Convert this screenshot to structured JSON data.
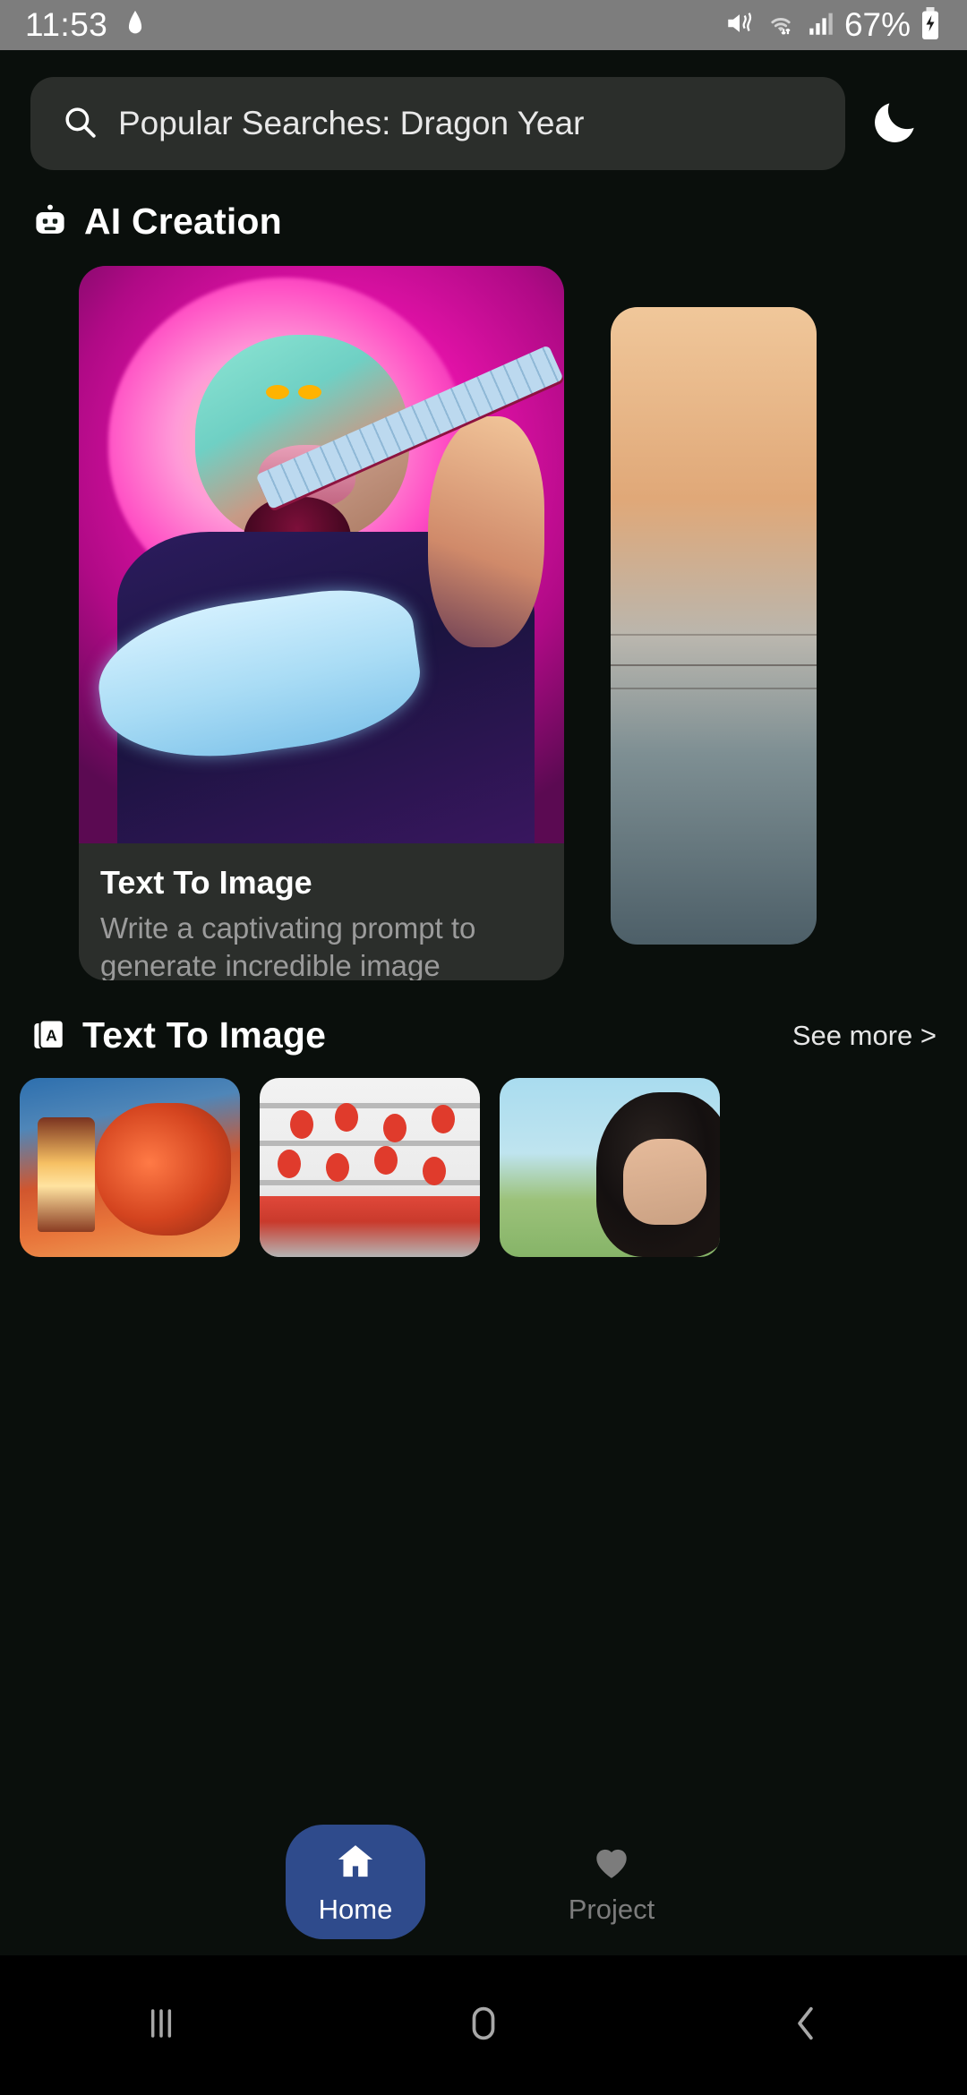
{
  "statusbar": {
    "time": "11:53",
    "battery_percent": "67%",
    "icons": [
      "home-indicator-icon",
      "mute-vibrate-icon",
      "wifi-icon",
      "signal-icon",
      "battery-charging-icon"
    ]
  },
  "search": {
    "placeholder": "Popular Searches: Dragon Year",
    "value": "",
    "icon": "search-icon",
    "theme_toggle_icon": "moon-icon"
  },
  "sections": [
    {
      "title": "AI Creation",
      "icon": "robot-icon",
      "cards": [
        {
          "title": "Text To Image",
          "description": "Write a captivating prompt to generate incredible image",
          "art": "neon-lion-playing-electric-guitar"
        },
        {
          "title": "",
          "description": "",
          "art": "sunset-landscape-peek"
        }
      ]
    },
    {
      "title": "Text To Image",
      "icon": "text-to-image-icon",
      "see_more": "See more >",
      "thumbnails": [
        {
          "art": "red-chinese-dragon-with-lantern"
        },
        {
          "art": "red-lanterns-street-scene"
        },
        {
          "art": "anime-man-black-hair"
        }
      ]
    }
  ],
  "tabbar": {
    "items": [
      {
        "label": "Home",
        "icon": "home-icon",
        "active": true
      },
      {
        "label": "Project",
        "icon": "heart-icon",
        "active": false
      }
    ]
  },
  "navbar": {
    "buttons": [
      {
        "icon": "recents-icon"
      },
      {
        "icon": "home-circle-icon"
      },
      {
        "icon": "back-chevron-icon"
      }
    ]
  },
  "colors": {
    "accent": "#2f4b8c",
    "app_background": "#0a0f0c",
    "card_background": "#2b2e2b",
    "status_bar": "#7d7d7d"
  }
}
